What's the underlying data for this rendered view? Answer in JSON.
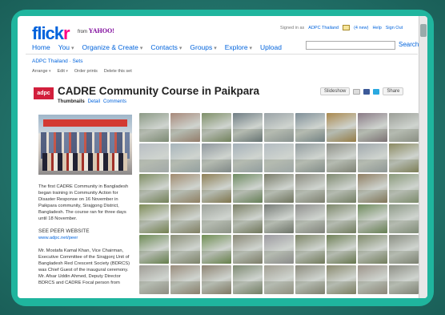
{
  "header": {
    "logo_part1": "flick",
    "logo_part2": "r",
    "from": "from",
    "yahoo": "YAHOO!",
    "nav": [
      "Home",
      "You",
      "Organize & Create",
      "Contacts",
      "Groups",
      "Explore",
      "Upload"
    ],
    "signed_in": "Signed in as",
    "user": "ADPC Thailand",
    "mail_count": "(4 new)",
    "help": "Help",
    "sign_out": "Sign Out",
    "search_label": "Search"
  },
  "breadcrumb": "ADPC Thailand · Sets",
  "toolbar": [
    "Arrange",
    "Edit",
    "Order prints",
    "Delete this set"
  ],
  "set": {
    "logo": "adpc",
    "title": "CADRE Community Course in Paikpara",
    "tabs": [
      "Thumbnails",
      "Detail",
      "Comments"
    ],
    "slideshow": "Slideshow",
    "share": "Share"
  },
  "description": {
    "p1": "The first CADRE Community in Bangladesh began training in Community Action for Disaster Response on 16 November in Paikpara community, Sirajgong District, Bangladesh. The course ran for three days until 18 November.",
    "see_peer": "SEE PEER WEBSITE",
    "peer_link": "www.adpc.net/peer",
    "p2": "Mr. Mostafa Kamal Khan, Vice Chairman, Executive Committee of the Sirajgonj Unit of Bangladesh Red Crescent Society (BDRCS) was Chief Guest of the inaugural ceremony. Mr. Afsar Uddin Ahmed, Deputy Director BDRCS and CADRE Focal person from"
  },
  "colors": {
    "thumbs": [
      "#8c9a86",
      "#a7897a",
      "#7e8f68",
      "#6f7d84",
      "#9aa3a7",
      "#7f8f98",
      "#a9884d",
      "#8a7b86",
      "#9b9e97",
      "#b8bec4",
      "#a7b4bb",
      "#8f979d",
      "#a4b0b9",
      "#b3bcc2",
      "#929c9f",
      "#8d8f86",
      "#a0a8ad",
      "#8b8a61",
      "#7f8e63",
      "#a18b6f",
      "#8e7f55",
      "#6e8b61",
      "#7a7d6a",
      "#8b8b7f",
      "#7f8a70",
      "#907f63",
      "#8a9a7a",
      "#7f8d58",
      "#8e8a6e",
      "#9ea39b",
      "#7a7f64",
      "#777c77",
      "#8f8f8d",
      "#7c8769",
      "#6e8b5b",
      "#8e9a88",
      "#6d8a54",
      "#8b8f78",
      "#6f8d52",
      "#8a8876",
      "#9c9aa0",
      "#7d8567",
      "#6f8056",
      "#7f8a6a",
      "#8a8e82",
      "#a09d96",
      "#9a8c7c",
      "#8e8372",
      "#7e8a72",
      "#a29f93",
      "#8d8c7e",
      "#8a8a6e",
      "#9d948a",
      "#8e8f86"
    ]
  }
}
